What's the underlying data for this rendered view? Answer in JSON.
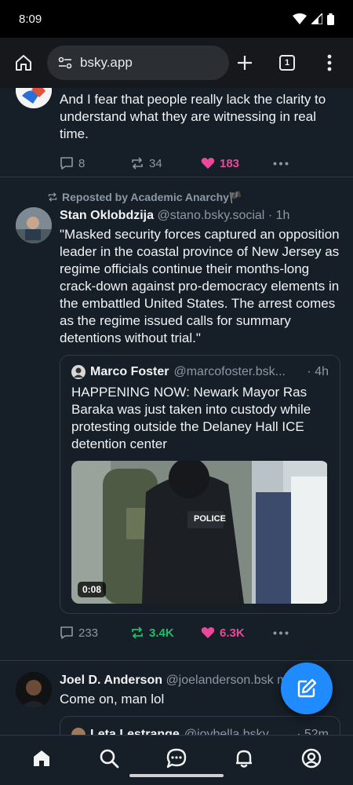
{
  "status_bar": {
    "time": "8:09"
  },
  "browser": {
    "url": "bsky.app",
    "tab_count": "1"
  },
  "posts": [
    {
      "text": "And I fear that people really lack the clarity to understand what they are witnessing in real time.",
      "replies": "8",
      "reposts": "34",
      "likes": "183"
    },
    {
      "repost_label": "Reposted by Academic Anarchy🏴",
      "author": "Stan Oklobdzija",
      "handle": "@stano.bsky.social",
      "time": "· 1h",
      "text": "\"Masked security forces captured an opposition leader in the coastal province of New Jersey as regime officials continue their months-long crack-down against pro-democracy elements in the embattled United States. The arrest comes as the regime issued calls for summary detentions without trial.\"",
      "quote": {
        "author": "Marco Foster",
        "handle": "@marcofoster.bsk...",
        "time": "· 4h",
        "text": "HAPPENING NOW: Newark Mayor Ras Baraka was just taken into custody while protesting outside the Delaney Hall ICE detention center",
        "video_duration": "0:08",
        "video_vest_text": "POLICE"
      },
      "replies": "233",
      "reposts": "3.4K",
      "likes": "6.3K"
    },
    {
      "author": "Joel D. Anderson",
      "handle": "@joelanderson.bsk",
      "time": "m",
      "text": "Come on, man lol",
      "quote": {
        "author": "Leta Lestrange",
        "handle": "@joybella.bsky...",
        "time": "· 52m"
      }
    }
  ],
  "colors": {
    "background": "#161e27",
    "like_pink": "#ec4899",
    "repost_green": "#20bc6a",
    "accent_blue": "#208bfe"
  },
  "icons": [
    "home-icon",
    "search-icon",
    "chat-icon",
    "bell-icon",
    "profile-icon",
    "compose-icon"
  ]
}
